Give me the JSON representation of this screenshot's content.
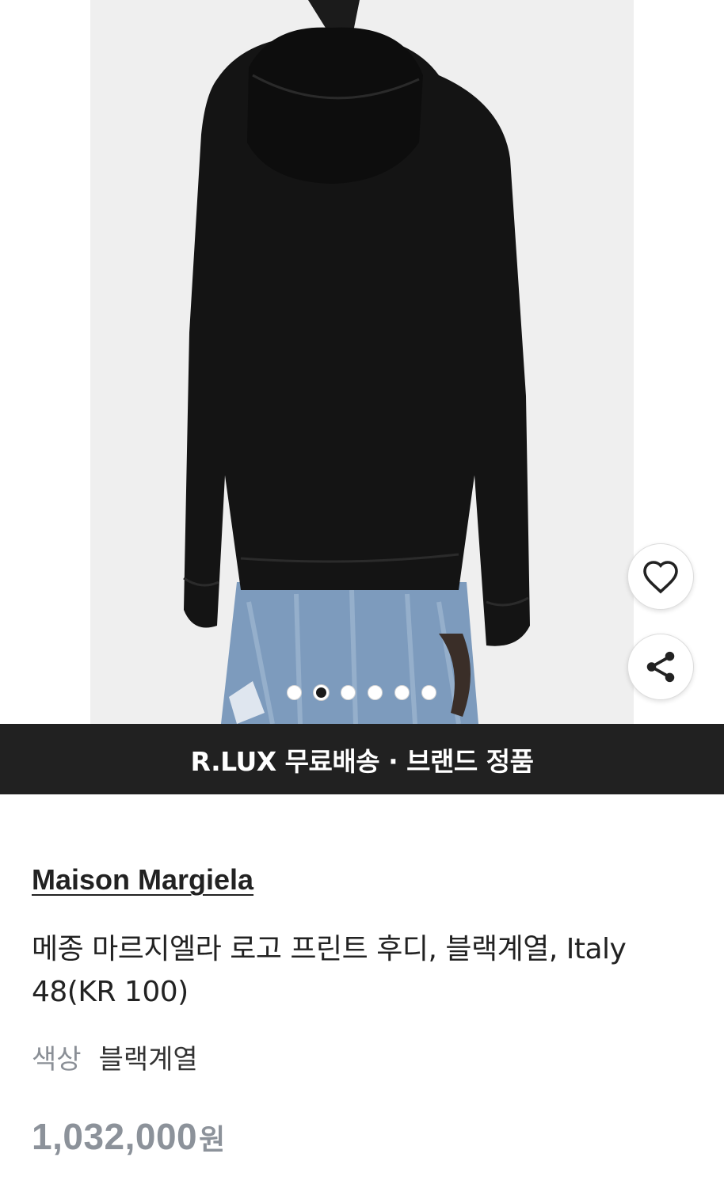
{
  "gallery": {
    "slide_count": 6,
    "active_slide_index": 1,
    "like_button_icon": "heart-outline-icon",
    "share_button_icon": "share-icon"
  },
  "banner": {
    "text": "R.LUX 무료배송 · 브랜드 정품"
  },
  "product": {
    "brand": "Maison Margiela",
    "title": "메종 마르지엘라 로고 프린트 후디, 블랙계열, Italy 48(KR 100)",
    "color_label": "색상",
    "color_value": "블랙계열",
    "price_amount": "1,032,000",
    "price_unit": "원"
  },
  "colors": {
    "banner_bg": "#212121",
    "price": "#8c929a",
    "label_gray": "#8a8f96"
  }
}
